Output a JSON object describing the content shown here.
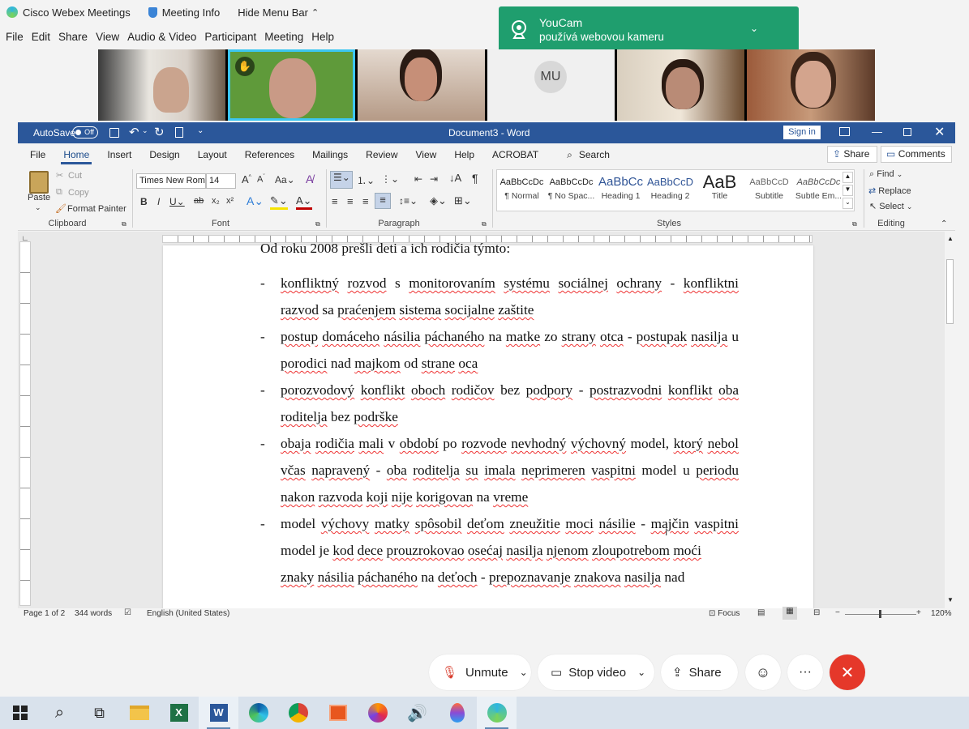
{
  "webex": {
    "app_name": "Cisco Webex Meetings",
    "meeting_info": "Meeting Info",
    "hide_menu_bar": "Hide Menu Bar",
    "menu": [
      "File",
      "Edit",
      "Share",
      "View",
      "Audio & Video",
      "Participant",
      "Meeting",
      "Help"
    ],
    "toast": {
      "title": "YouCam",
      "subtitle": "používá webovou kameru"
    },
    "participant_initials": "MU",
    "controls": {
      "unmute": "Unmute",
      "stop_video": "Stop video",
      "share": "Share",
      "more": "···"
    }
  },
  "word": {
    "autosave": "AutoSave",
    "autosave_state": "Off",
    "doc_title": "Document3 - Word",
    "sign_in": "Sign in",
    "tabs": [
      "File",
      "Home",
      "Insert",
      "Design",
      "Layout",
      "References",
      "Mailings",
      "Review",
      "View",
      "Help",
      "ACROBAT"
    ],
    "active_tab": "Home",
    "search": "Search",
    "share": "Share",
    "comments": "Comments",
    "clipboard": {
      "paste": "Paste",
      "cut": "Cut",
      "copy": "Copy",
      "format_painter": "Format Painter",
      "label": "Clipboard"
    },
    "font": {
      "name": "Times New Rom",
      "size": "14",
      "label": "Font"
    },
    "paragraph_label": "Paragraph",
    "styles_label": "Styles",
    "styles": [
      {
        "preview": "AaBbCcDc",
        "name": "¶ Normal"
      },
      {
        "preview": "AaBbCcDc",
        "name": "¶ No Spac..."
      },
      {
        "preview": "AaBbCc",
        "name": "Heading 1"
      },
      {
        "preview": "AaBbCcD",
        "name": "Heading 2"
      },
      {
        "preview": "AaB",
        "name": "Title"
      },
      {
        "preview": "AaBbCcD",
        "name": "Subtitle"
      },
      {
        "preview": "AaBbCcDc",
        "name": "Subtle Em..."
      }
    ],
    "editing": {
      "find": "Find",
      "replace": "Replace",
      "select": "Select",
      "label": "Editing"
    },
    "status": {
      "page": "Page 1 of 2",
      "words": "344 words",
      "language": "English (United States)",
      "focus": "Focus",
      "zoom": "120%"
    }
  },
  "document": {
    "intro": "Od roku 2008 prešli deti a ich rodičia týmto:"
  }
}
